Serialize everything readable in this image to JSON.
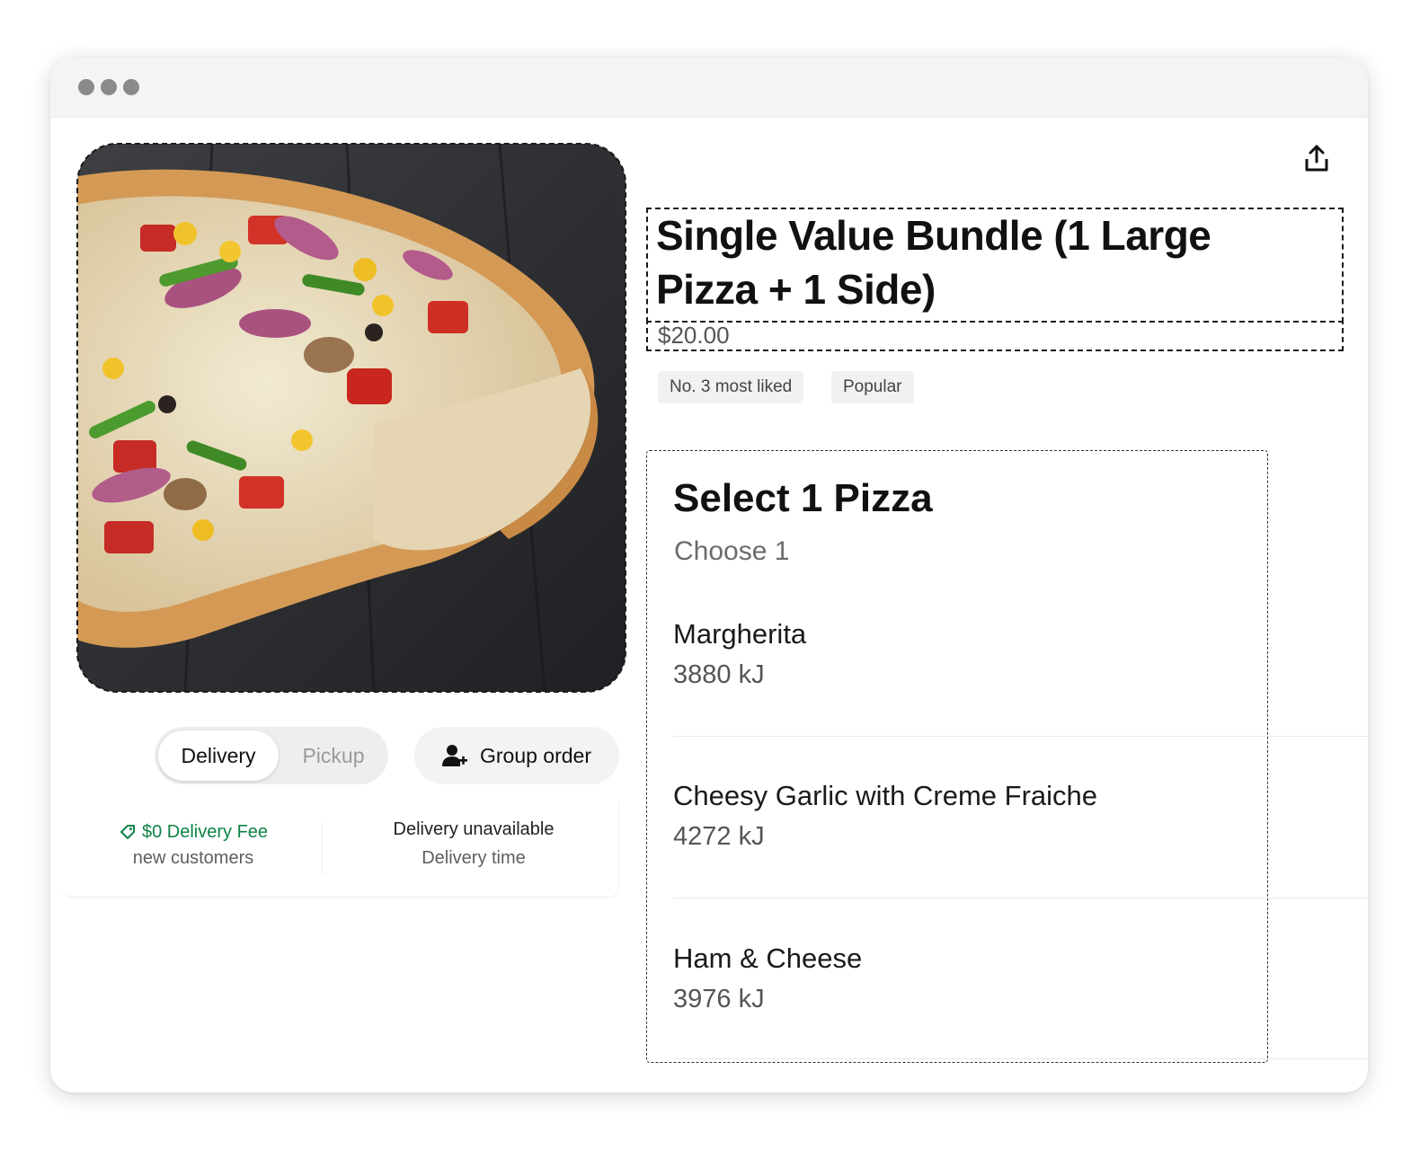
{
  "product": {
    "title": "Single Value Bundle (1 Large Pizza + 1 Side)",
    "price": "$20.00",
    "tags": [
      "No. 3 most liked",
      "Popular"
    ]
  },
  "ordering": {
    "delivery_label": "Delivery",
    "pickup_label": "Pickup",
    "group_order_label": "Group order"
  },
  "info": {
    "fee": "$0 Delivery Fee",
    "fee_note": "new customers",
    "availability": "Delivery unavailable",
    "availability_note": "Delivery time"
  },
  "options": {
    "title": "Select 1 Pizza",
    "subtitle": "Choose 1",
    "items": [
      {
        "name": "Margherita",
        "energy": "3880 kJ"
      },
      {
        "name": "Cheesy Garlic with Creme Fraiche",
        "energy": "4272 kJ"
      },
      {
        "name": "Ham & Cheese",
        "energy": "3976 kJ"
      }
    ]
  },
  "icons": {
    "share": "share-icon",
    "group": "add-person-icon",
    "fee": "tag-icon"
  },
  "colors": {
    "accent_green": "#0e8345",
    "text_primary": "#111111",
    "text_secondary": "#5e5e5e"
  }
}
